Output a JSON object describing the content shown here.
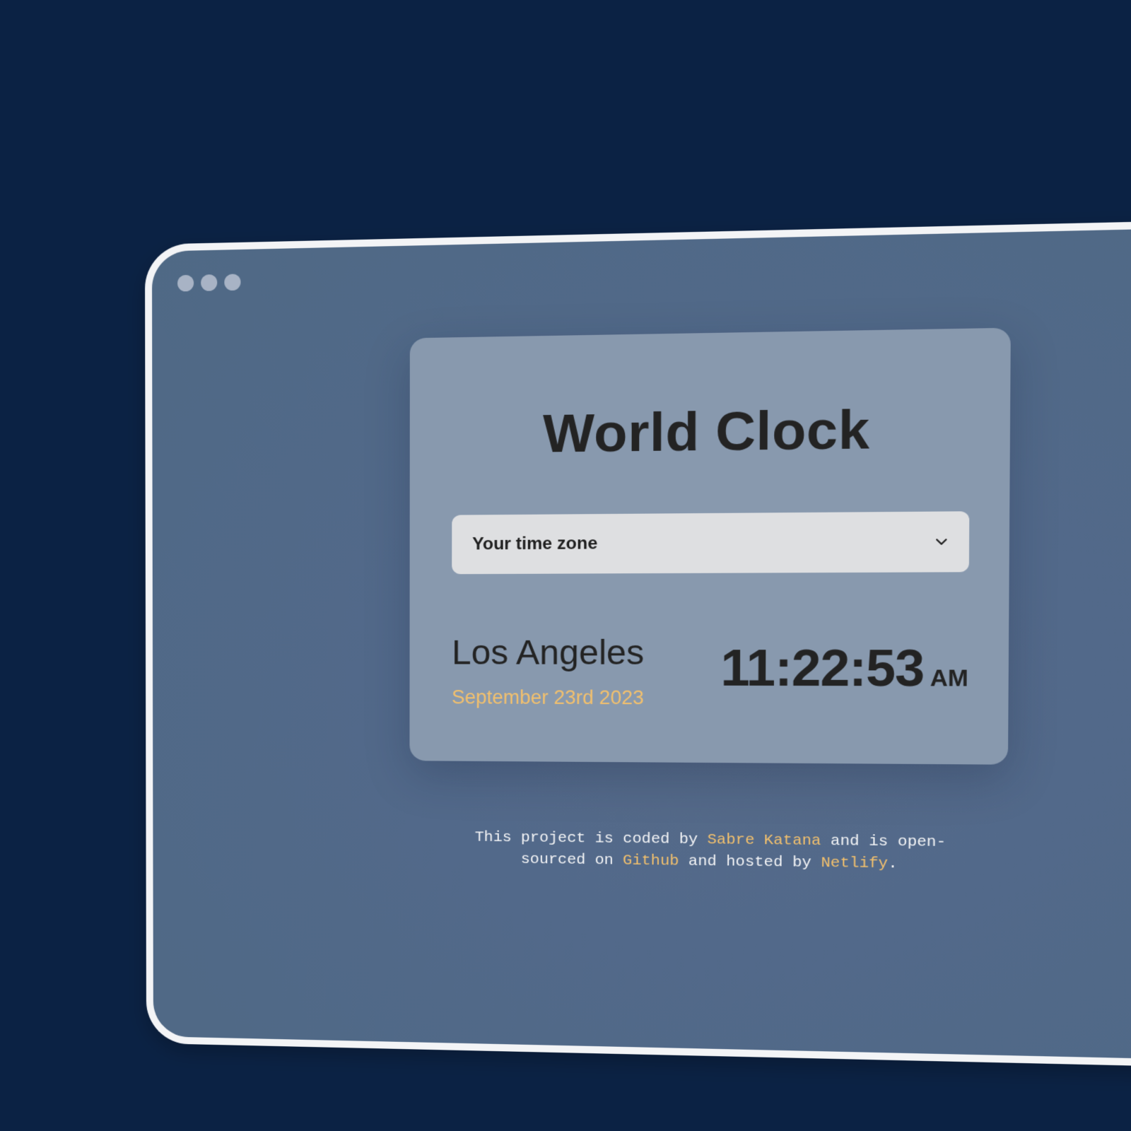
{
  "window": {
    "controls": [
      "dot",
      "dot",
      "dot"
    ]
  },
  "card": {
    "title": "World Clock",
    "timezone_select": {
      "selected": "Your time zone"
    },
    "city": {
      "name": "Los Angeles",
      "date": "September 23rd 2023",
      "time": "11:22:53",
      "period": "AM"
    }
  },
  "footer": {
    "text_1": "This project is coded by ",
    "author_link": "Sabre Katana",
    "text_2": " and is open-sourced on ",
    "github_link": "Github",
    "text_3": " and hosted by ",
    "netlify_link": "Netlify",
    "text_4": "."
  },
  "colors": {
    "page_background": "#0b2244",
    "window_background": "#52698a",
    "card_background": "#8899ae",
    "accent": "#f2c06d",
    "select_background": "#dedfe1",
    "text_dark": "#232323"
  }
}
